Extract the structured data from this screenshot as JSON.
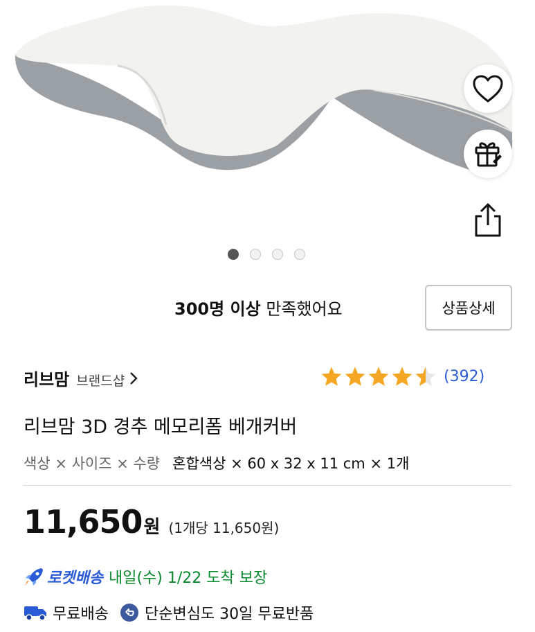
{
  "gallery": {
    "total_images": 4,
    "active_index": 0
  },
  "actions": {
    "wishlist_icon": "heart-icon",
    "gift_icon": "gift-rocket-icon",
    "share_icon": "share-icon"
  },
  "satisfaction": {
    "count": "300명 이상",
    "text": "만족했어요"
  },
  "detail_button": "상품상세",
  "brand": {
    "name": "리브맘",
    "shop_label": "브랜드샵",
    "chevron": "›"
  },
  "rating": {
    "stars": 4.5,
    "count": "(392)",
    "star_color": "#f5a623"
  },
  "product": {
    "title": "리브맘 3D 경추 메모리폼 베개커버"
  },
  "options": {
    "label": "색상 × 사이즈 × 수량",
    "value": "혼합색상 × 60 x 32 x 11 cm × 1개"
  },
  "price": {
    "amount": "11,650",
    "currency": "원",
    "unit_price": "(1개당 11,650원)"
  },
  "delivery": {
    "rocket_label": "로켓배송",
    "eta": "내일(수) 1/22 도착 보장",
    "free_shipping": "무료배송",
    "return_policy": "단순변심도 30일 무료반품"
  },
  "colors": {
    "rocket_blue": "#2a5bd7",
    "eta_green": "#0a8a2e",
    "star": "#f5a623"
  }
}
